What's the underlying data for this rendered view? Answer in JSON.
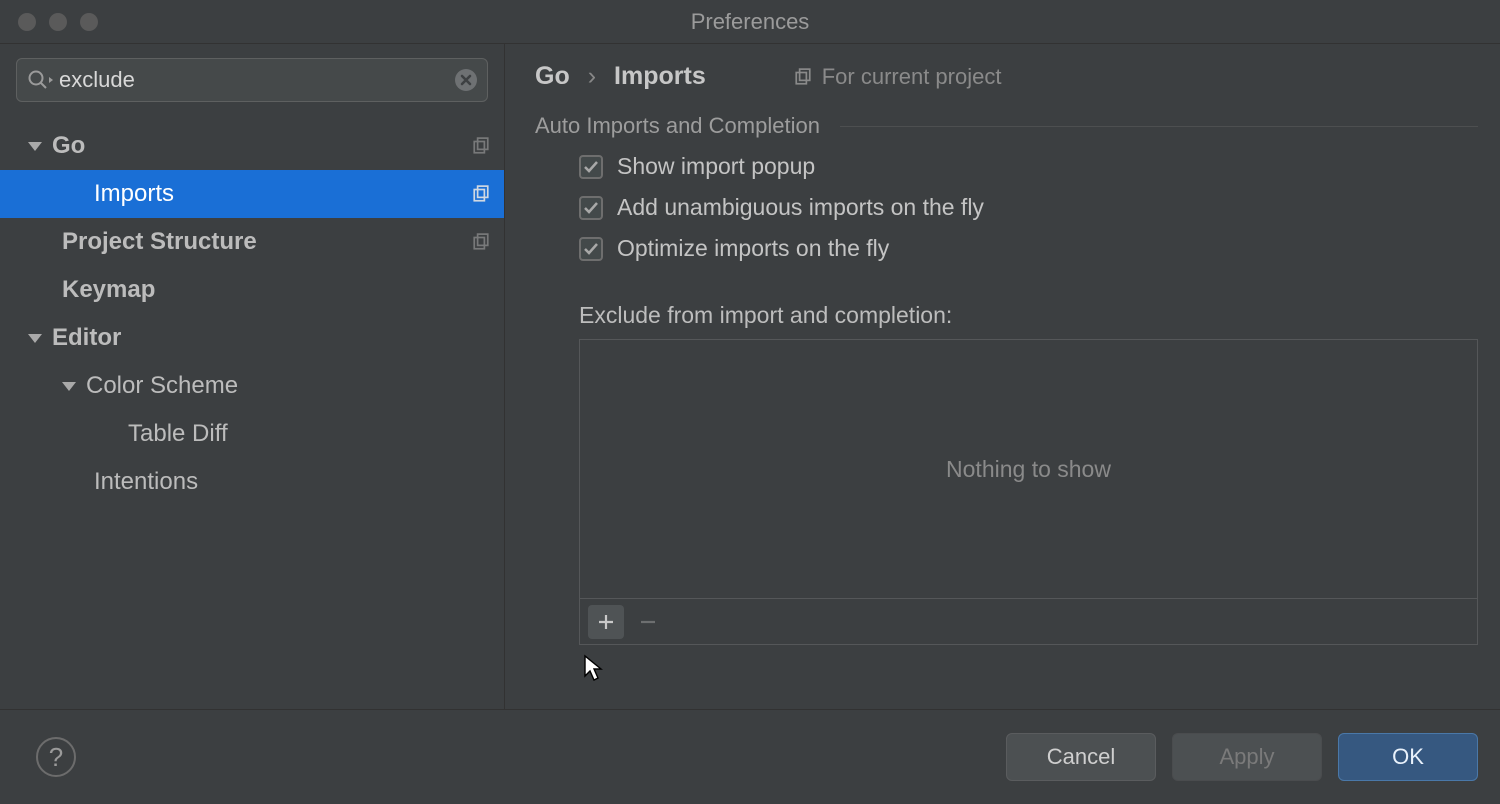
{
  "window": {
    "title": "Preferences"
  },
  "search": {
    "value": "exclude"
  },
  "sidebar": {
    "items": [
      {
        "label": "Go"
      },
      {
        "label": "Imports"
      },
      {
        "label": "Project Structure"
      },
      {
        "label": "Keymap"
      },
      {
        "label": "Editor"
      },
      {
        "label": "Color Scheme"
      },
      {
        "label": "Table Diff"
      },
      {
        "label": "Intentions"
      }
    ]
  },
  "breadcrumb": {
    "a": "Go",
    "b": "Imports",
    "scope": "For current project"
  },
  "section": {
    "auto_label": "Auto Imports and Completion",
    "checks": [
      "Show import popup",
      "Add unambiguous imports on the fly",
      "Optimize imports on the fly"
    ],
    "exclude_label": "Exclude from import and completion:",
    "empty": "Nothing to show"
  },
  "footer": {
    "cancel": "Cancel",
    "apply": "Apply",
    "ok": "OK",
    "help": "?"
  }
}
